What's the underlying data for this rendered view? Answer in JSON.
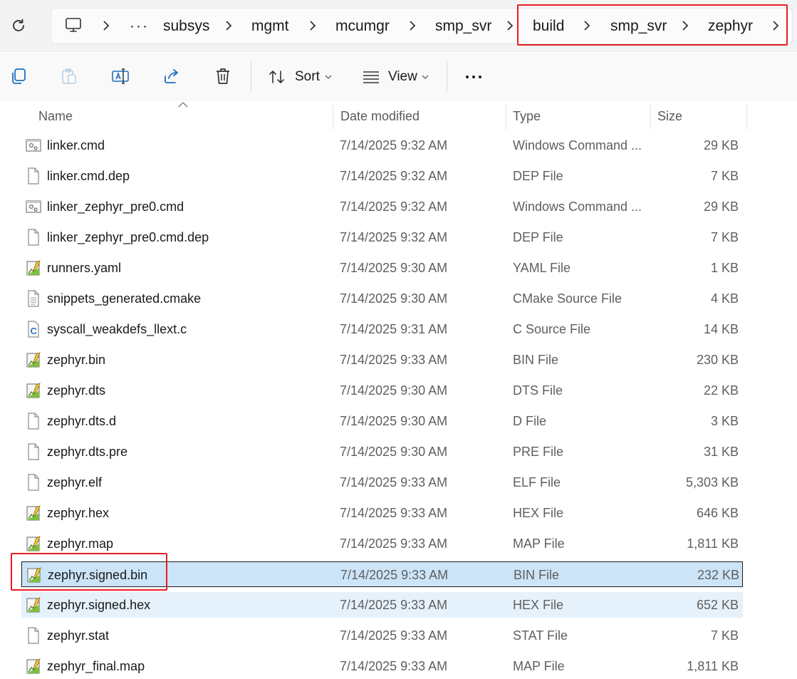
{
  "breadcrumb": {
    "items": [
      "subsys",
      "mgmt",
      "mcumgr",
      "smp_svr",
      "build",
      "smp_svr",
      "zephyr"
    ],
    "overflow": "···"
  },
  "toolbar": {
    "sort_label": "Sort",
    "view_label": "View"
  },
  "columns": {
    "name": "Name",
    "date": "Date modified",
    "type": "Type",
    "size": "Size"
  },
  "files": [
    {
      "name": "linker.cmd",
      "date": "7/14/2025 9:32 AM",
      "type": "Windows Command ...",
      "size": "29 KB",
      "icon": "cmd-file-icon"
    },
    {
      "name": "linker.cmd.dep",
      "date": "7/14/2025 9:32 AM",
      "type": "DEP File",
      "size": "7 KB",
      "icon": "blank-file-icon"
    },
    {
      "name": "linker_zephyr_pre0.cmd",
      "date": "7/14/2025 9:32 AM",
      "type": "Windows Command ...",
      "size": "29 KB",
      "icon": "cmd-file-icon"
    },
    {
      "name": "linker_zephyr_pre0.cmd.dep",
      "date": "7/14/2025 9:32 AM",
      "type": "DEP File",
      "size": "7 KB",
      "icon": "blank-file-icon"
    },
    {
      "name": "runners.yaml",
      "date": "7/14/2025 9:30 AM",
      "type": "YAML File",
      "size": "1 KB",
      "icon": "notepadpp-file-icon"
    },
    {
      "name": "snippets_generated.cmake",
      "date": "7/14/2025 9:30 AM",
      "type": "CMake Source File",
      "size": "4 KB",
      "icon": "text-file-icon"
    },
    {
      "name": "syscall_weakdefs_llext.c",
      "date": "7/14/2025 9:31 AM",
      "type": "C Source File",
      "size": "14 KB",
      "icon": "c-source-file-icon"
    },
    {
      "name": "zephyr.bin",
      "date": "7/14/2025 9:33 AM",
      "type": "BIN File",
      "size": "230 KB",
      "icon": "notepadpp-file-icon"
    },
    {
      "name": "zephyr.dts",
      "date": "7/14/2025 9:30 AM",
      "type": "DTS File",
      "size": "22 KB",
      "icon": "notepadpp-file-icon"
    },
    {
      "name": "zephyr.dts.d",
      "date": "7/14/2025 9:30 AM",
      "type": "D File",
      "size": "3 KB",
      "icon": "blank-file-icon"
    },
    {
      "name": "zephyr.dts.pre",
      "date": "7/14/2025 9:30 AM",
      "type": "PRE File",
      "size": "31 KB",
      "icon": "blank-file-icon"
    },
    {
      "name": "zephyr.elf",
      "date": "7/14/2025 9:33 AM",
      "type": "ELF File",
      "size": "5,303 KB",
      "icon": "blank-file-icon"
    },
    {
      "name": "zephyr.hex",
      "date": "7/14/2025 9:33 AM",
      "type": "HEX File",
      "size": "646 KB",
      "icon": "notepadpp-file-icon"
    },
    {
      "name": "zephyr.map",
      "date": "7/14/2025 9:33 AM",
      "type": "MAP File",
      "size": "1,811 KB",
      "icon": "notepadpp-file-icon"
    },
    {
      "name": "zephyr.signed.bin",
      "date": "7/14/2025 9:33 AM",
      "type": "BIN File",
      "size": "232 KB",
      "icon": "notepadpp-file-icon",
      "state": "selected"
    },
    {
      "name": "zephyr.signed.hex",
      "date": "7/14/2025 9:33 AM",
      "type": "HEX File",
      "size": "652 KB",
      "icon": "notepadpp-file-icon",
      "state": "hover"
    },
    {
      "name": "zephyr.stat",
      "date": "7/14/2025 9:33 AM",
      "type": "STAT File",
      "size": "7 KB",
      "icon": "blank-file-icon"
    },
    {
      "name": "zephyr_final.map",
      "date": "7/14/2025 9:33 AM",
      "type": "MAP File",
      "size": "1,811 KB",
      "icon": "notepadpp-file-icon"
    }
  ],
  "colors": {
    "highlight_red": "#e81c24",
    "selection": "#cce4f7",
    "hover": "#e5f1fb"
  }
}
